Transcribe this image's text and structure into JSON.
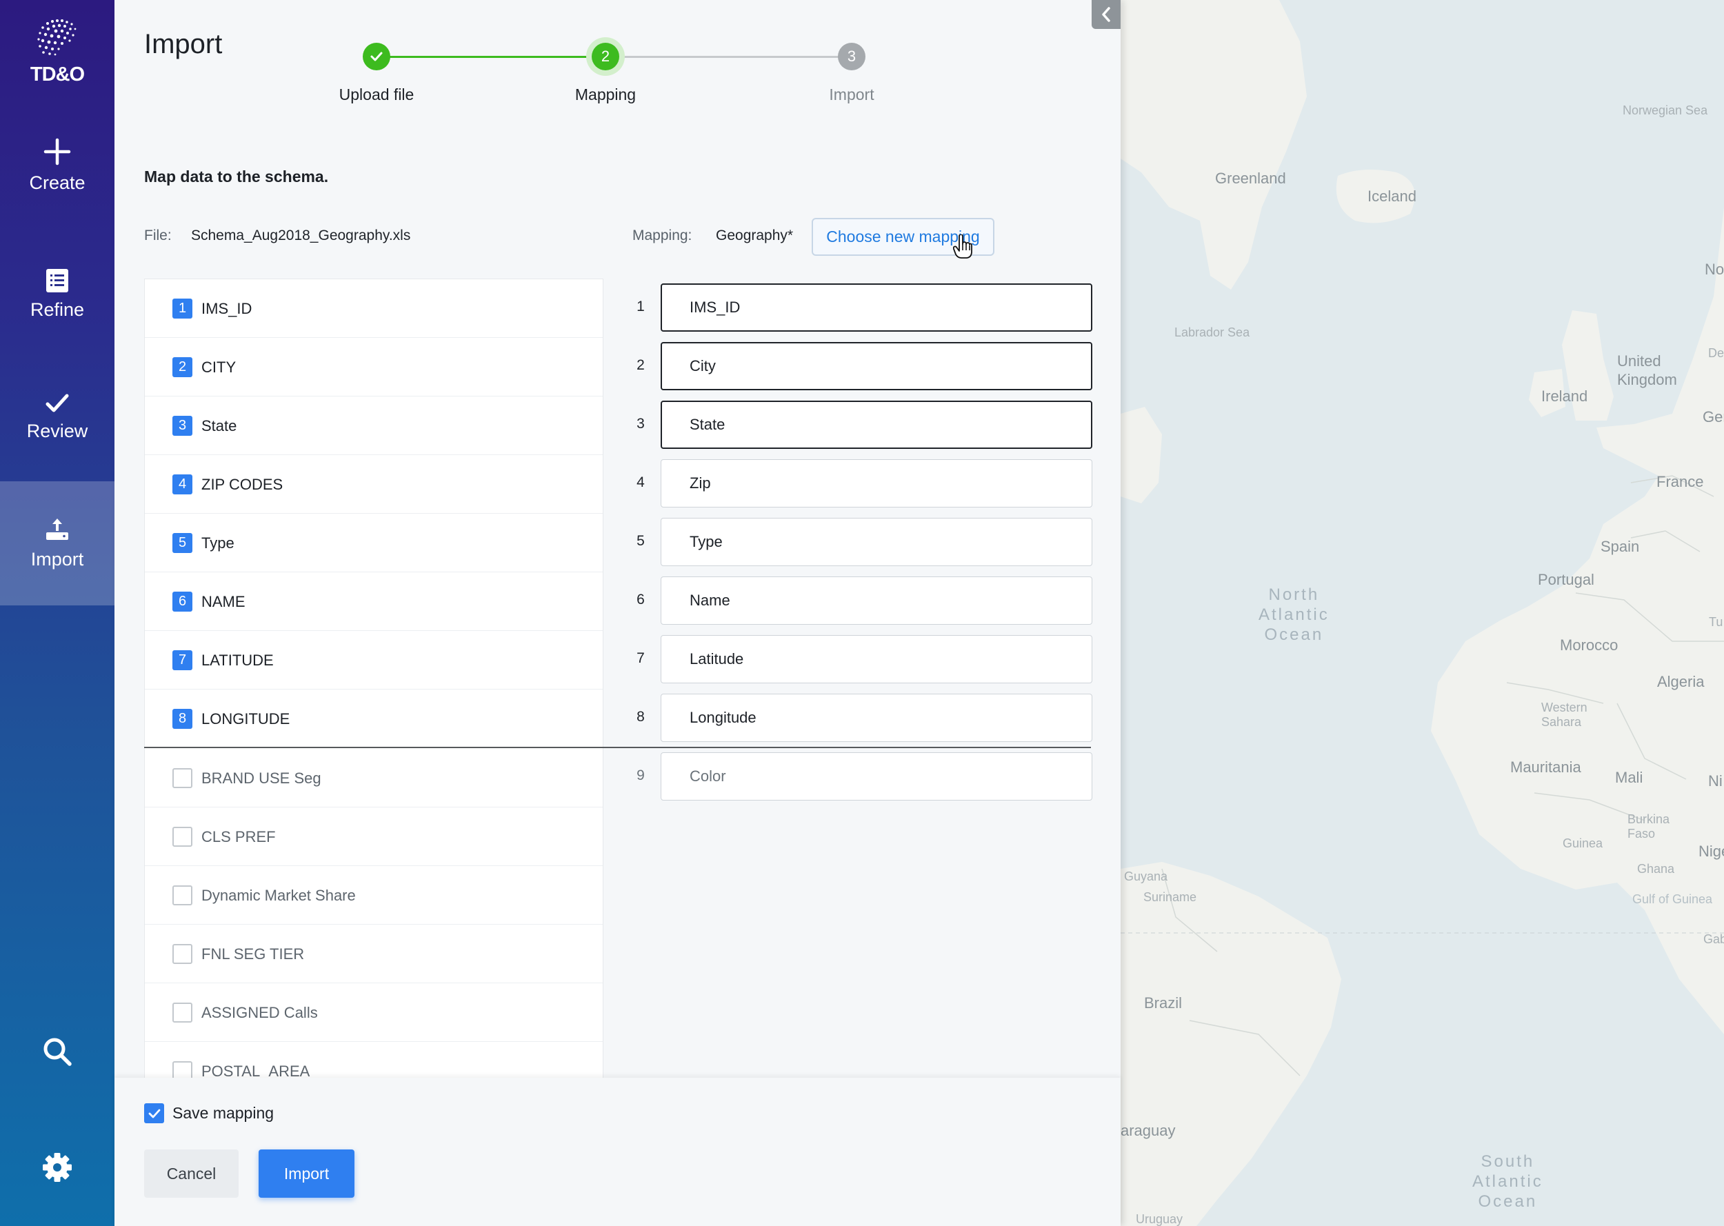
{
  "sidebar": {
    "brand": "TD&O",
    "items": [
      {
        "label": "Create",
        "icon": "plus-icon"
      },
      {
        "label": "Refine",
        "icon": "list-icon"
      },
      {
        "label": "Review",
        "icon": "check-icon"
      },
      {
        "label": "Import",
        "icon": "upload-icon"
      }
    ],
    "active": "Import"
  },
  "panel": {
    "title": "Import",
    "steps": [
      {
        "number": "1",
        "label": "Upload file",
        "state": "complete"
      },
      {
        "number": "2",
        "label": "Mapping",
        "state": "current"
      },
      {
        "number": "3",
        "label": "Import",
        "state": "pending"
      }
    ],
    "intro": "Map data to the schema.",
    "file_label": "File:",
    "file_name": "Schema_Aug2018_Geography.xls",
    "mapping_label": "Mapping:",
    "mapping_name": "Geography*",
    "choose_mapping_label": "Choose new mapping",
    "source_columns": [
      {
        "label": "IMS_ID",
        "index": "1",
        "mapped": true
      },
      {
        "label": "CITY",
        "index": "2",
        "mapped": true
      },
      {
        "label": "State",
        "index": "3",
        "mapped": true
      },
      {
        "label": "ZIP CODES",
        "index": "4",
        "mapped": true
      },
      {
        "label": "Type",
        "index": "5",
        "mapped": true
      },
      {
        "label": "NAME",
        "index": "6",
        "mapped": true
      },
      {
        "label": "LATITUDE",
        "index": "7",
        "mapped": true
      },
      {
        "label": "LONGITUDE",
        "index": "8",
        "mapped": true
      },
      {
        "label": "BRAND USE Seg",
        "mapped": false
      },
      {
        "label": "CLS PREF",
        "mapped": false
      },
      {
        "label": "Dynamic Market Share",
        "mapped": false
      },
      {
        "label": "FNL SEG TIER",
        "mapped": false
      },
      {
        "label": "ASSIGNED Calls",
        "mapped": false
      },
      {
        "label": "POSTAL_AREA",
        "mapped": false
      }
    ],
    "target_fields": [
      {
        "number": "1",
        "label": "IMS_ID",
        "required": true
      },
      {
        "number": "2",
        "label": "City",
        "required": true
      },
      {
        "number": "3",
        "label": "State",
        "required": true
      },
      {
        "number": "4",
        "label": "Zip",
        "required": false
      },
      {
        "number": "5",
        "label": "Type",
        "required": false
      },
      {
        "number": "6",
        "label": "Name",
        "required": false
      },
      {
        "number": "7",
        "label": "Latitude",
        "required": false
      },
      {
        "number": "8",
        "label": "Longitude",
        "required": false
      },
      {
        "number": "9",
        "label": "Color",
        "required": false,
        "unmapped": true
      }
    ],
    "save_mapping_label": "Save mapping",
    "save_mapping_checked": true,
    "cancel_label": "Cancel",
    "import_label": "Import"
  },
  "map": {
    "labels": {
      "greenland": "Greenland",
      "iceland": "Iceland",
      "norwegian_sea": "Norwegian Sea",
      "labrador_sea": "Labrador Sea",
      "ireland": "Ireland",
      "united_kingdom": "United\nKingdom",
      "france": "France",
      "spain": "Spain",
      "portugal": "Portugal",
      "morocco": "Morocco",
      "algeria": "Algeria",
      "western_sahara": "Western\nSahara",
      "mauritania": "Mauritania",
      "mali": "Mali",
      "burkina_faso": "Burkina\nFaso",
      "guinea": "Guinea",
      "ghana": "Ghana",
      "gulf_of_guinea": "Gulf of Guinea",
      "guyana": "Guyana",
      "suriname": "Suriname",
      "brazil": "Brazil",
      "paraguay": "araguay",
      "uruguay": "Uruguay",
      "north_atlantic": "North\nAtlantic\nOcean",
      "south_atlantic": "South\nAtlantic\nOcean",
      "nor": "Nor",
      "den": "Den",
      "ger": "Gerr",
      "tun": "Tu",
      "nig": "Ni",
      "nige": "Nige",
      "gab": "Gab"
    },
    "colors": {
      "ocean": "#e1eaed",
      "land": "#f1f2ee"
    }
  },
  "colors": {
    "accent": "#2f7ff0",
    "step_complete": "#3dbb1f",
    "step_pending": "#a5a9ad",
    "sidebar_top": "#2c1a80",
    "sidebar_bottom": "#0f6fab"
  }
}
